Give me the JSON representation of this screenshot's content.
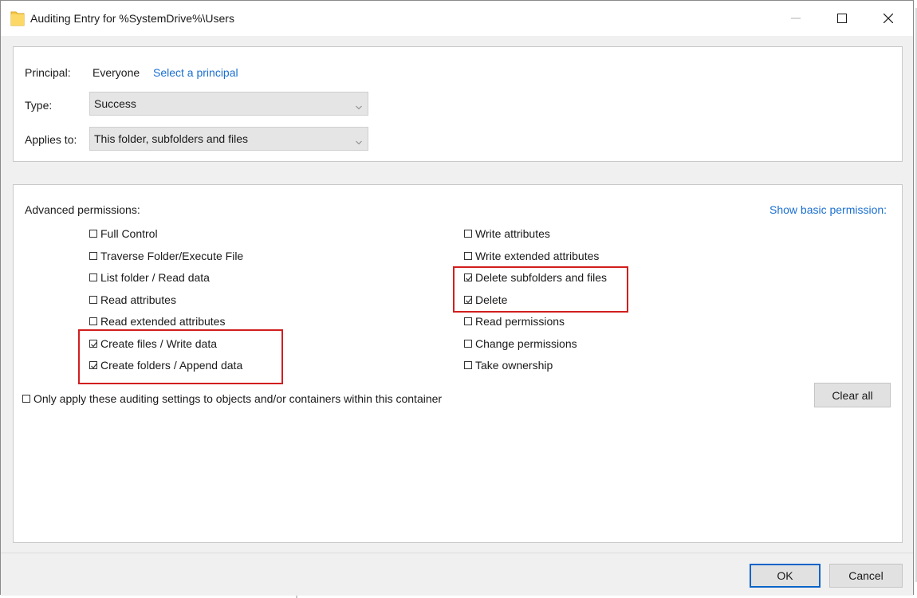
{
  "window": {
    "title": "Auditing Entry for %SystemDrive%\\Users"
  },
  "principal": {
    "label": "Principal:",
    "value": "Everyone",
    "link": "Select a principal"
  },
  "type": {
    "label": "Type:",
    "value": "Success"
  },
  "applies_to": {
    "label": "Applies to:",
    "value": "This folder, subfolders and files"
  },
  "advanced": {
    "heading": "Advanced permissions:",
    "toggle_link": "Show basic permission:",
    "left": [
      {
        "label": "Full Control",
        "checked": false
      },
      {
        "label": "Traverse Folder/Execute File",
        "checked": false
      },
      {
        "label": "List folder / Read data",
        "checked": false
      },
      {
        "label": "Read attributes",
        "checked": false
      },
      {
        "label": "Read extended attributes",
        "checked": false
      },
      {
        "label": "Create files / Write data",
        "checked": true
      },
      {
        "label": "Create folders / Append data",
        "checked": true
      }
    ],
    "right": [
      {
        "label": "Write attributes",
        "checked": false
      },
      {
        "label": "Write extended attributes",
        "checked": false
      },
      {
        "label": "Delete subfolders and files",
        "checked": true
      },
      {
        "label": "Delete",
        "checked": true
      },
      {
        "label": "Read permissions",
        "checked": false
      },
      {
        "label": "Change permissions",
        "checked": false
      },
      {
        "label": "Take ownership",
        "checked": false
      }
    ],
    "only_apply": {
      "label": "Only apply these auditing settings to objects and/or containers within this container",
      "checked": false
    },
    "clear_all": "Clear all"
  },
  "buttons": {
    "ok": "OK",
    "cancel": "Cancel"
  },
  "colors": {
    "highlight": "#d21e1e",
    "link": "#1a6fd1",
    "primary_border": "#0a64c8"
  }
}
